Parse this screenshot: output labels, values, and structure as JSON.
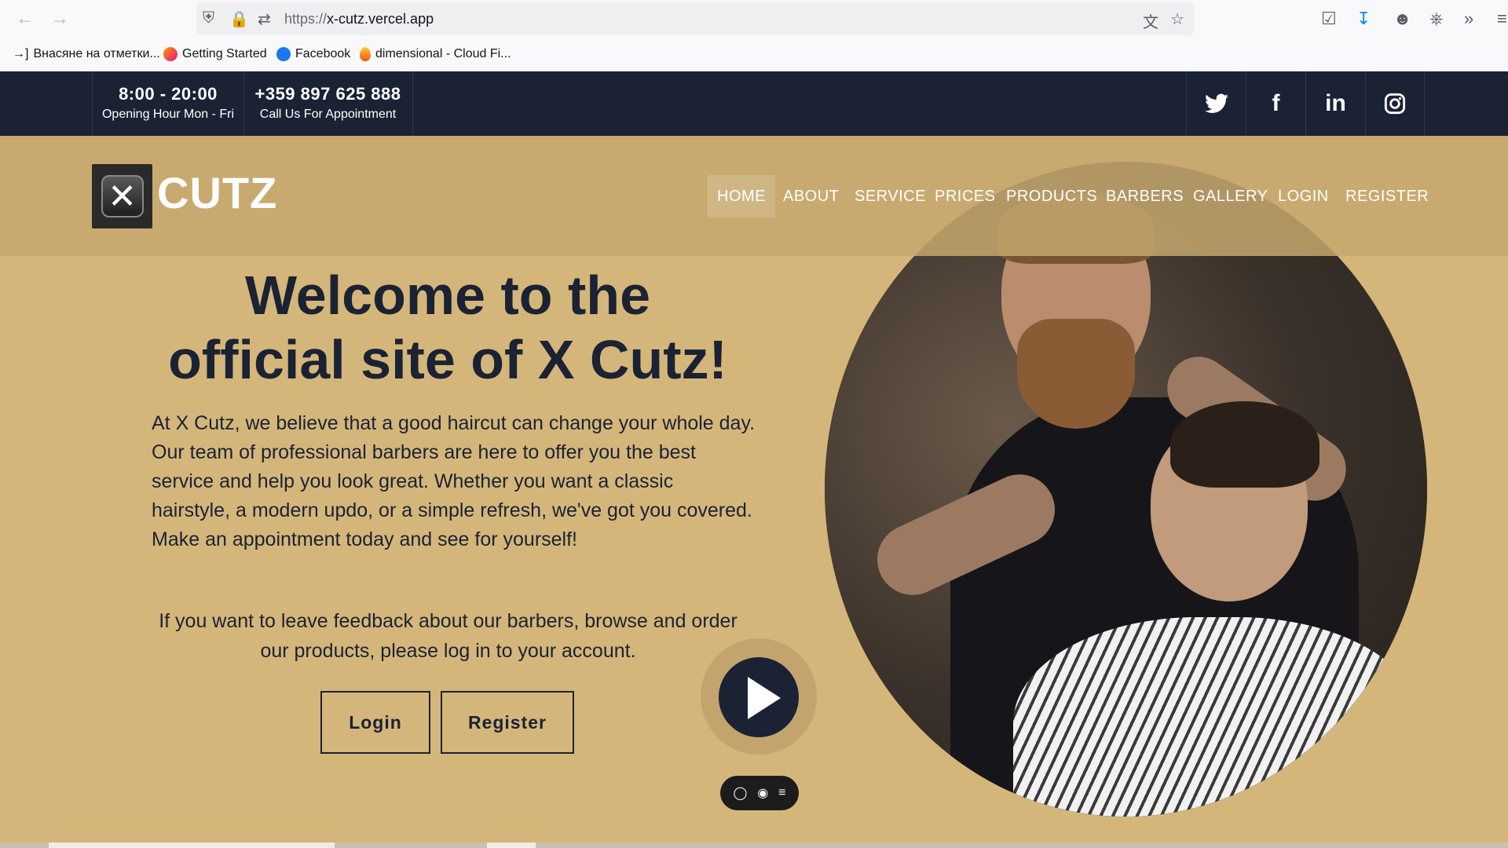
{
  "browser": {
    "url_scheme": "https://",
    "url_host": "x-cutz.vercel.app",
    "back_icon": "arrow-left-icon",
    "forward_icon": "arrow-right-icon"
  },
  "bookmarks": [
    {
      "label": "Внасяне на отметки...",
      "icon": "import-icon"
    },
    {
      "label": "Getting Started",
      "icon": "firefox-icon"
    },
    {
      "label": "Facebook",
      "icon": "facebook-icon"
    },
    {
      "label": "dimensional - Cloud Fi...",
      "icon": "flame-icon"
    }
  ],
  "topbar": {
    "hours": "8:00 - 20:00",
    "hours_label": "Opening Hour Mon - Fri",
    "phone": "+359 897 625 888",
    "phone_label": "Call Us For Appointment",
    "socials": [
      "twitter-icon",
      "facebook-icon",
      "linkedin-icon",
      "instagram-icon"
    ]
  },
  "header": {
    "logo_text": "CUTZ",
    "nav": [
      "HOME",
      "ABOUT",
      "SERVICE",
      "PRICES",
      "PRODUCTS",
      "BARBERS",
      "GALLERY",
      "LOGIN",
      "REGISTER"
    ],
    "active_nav": "HOME"
  },
  "hero": {
    "title_line1": "Welcome to the",
    "title_line2": "official site of X Cutz!",
    "text": "At X Cutz, we believe that a good haircut can change your whole day. Our team of professional barbers are here to offer you the best service and help you look great. Whether you want a classic hairstyle, a modern updo, or a simple refresh, we've got you covered. Make an appointment today and see for yourself!",
    "note": "If you want to leave feedback about our barbers, browse and order our products, please log in to your account.",
    "login_label": "Login",
    "register_label": "Register"
  },
  "colors": {
    "navy": "#1a2234",
    "tan": "#d4b67a",
    "header_tan": "#c6a86e"
  }
}
